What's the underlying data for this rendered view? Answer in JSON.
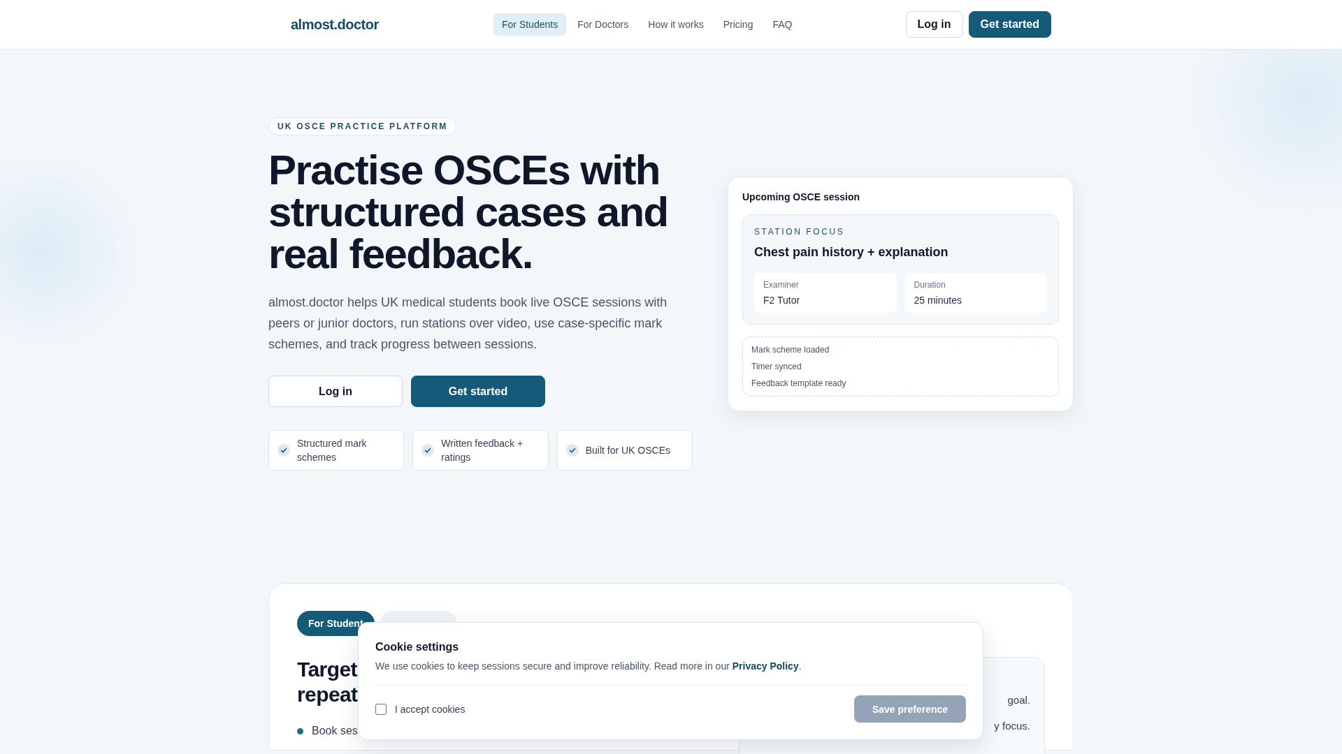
{
  "header": {
    "logo": "almost.doctor",
    "nav": [
      {
        "label": "For Students",
        "selected": true
      },
      {
        "label": "For Doctors",
        "selected": false
      },
      {
        "label": "How it works",
        "selected": false
      },
      {
        "label": "Pricing",
        "selected": false
      },
      {
        "label": "FAQ",
        "selected": false
      }
    ],
    "buttons": [
      {
        "label": "Log in",
        "kind": "secondary"
      },
      {
        "label": "Get started",
        "kind": "primary"
      }
    ]
  },
  "hero": {
    "badge": "UK OSCE PRACTICE PLATFORM",
    "title": "Practise OSCEs with structured cases and real feedback.",
    "text": "almost.doctor helps UK medical students book live OSCE sessions with peers or junior doctors, run stations over video, use case-specific mark schemes, and track progress between sessions.",
    "buttons": [
      {
        "label": "Log in",
        "kind": "secondary"
      },
      {
        "label": "Get started",
        "kind": "primary"
      }
    ],
    "features": [
      "Structured mark schemes",
      "Written feedback + ratings",
      "Built for UK OSCEs"
    ]
  },
  "session_card": {
    "title": "Upcoming OSCE session",
    "eyebrow": "STATION FOCUS",
    "station": "Chest pain history + explanation",
    "details": [
      {
        "label": "Examiner",
        "value": "F2 Tutor"
      },
      {
        "label": "Duration",
        "value": "25 minutes"
      }
    ],
    "checklist": [
      "Mark scheme loaded",
      "Timer synced",
      "Feedback template ready"
    ]
  },
  "audience": {
    "tabs": [
      {
        "label": "For Student",
        "selected": true
      },
      {
        "selected": false
      }
    ],
    "heading_lines": [
      "Target",
      "repeat"
    ],
    "bullets": [
      "Book ses"
    ],
    "panel_lines": [
      "goal.",
      "y focus."
    ]
  },
  "cookie_dialog": {
    "title": "Cookie settings",
    "text": "We use cookies to keep sessions secure and improve reliability. Read more in our ",
    "link": "Privacy Policy",
    "text_end": ".",
    "checkbox": {
      "label": "I accept cookies",
      "checked": false
    },
    "button": {
      "label": "Save preference",
      "disabled": true
    }
  }
}
